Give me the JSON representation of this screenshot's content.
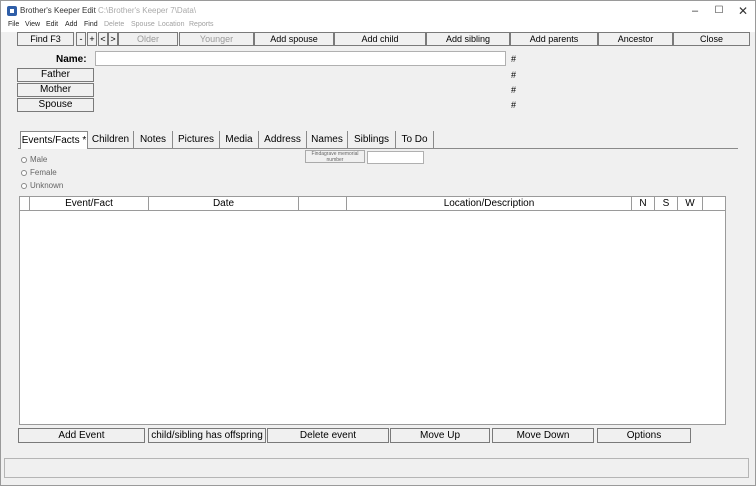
{
  "window": {
    "title_main": "Brother's Keeper Edit",
    "title_path": "C:\\Brother's Keeper 7\\Data\\",
    "controls": {
      "minimize": "–",
      "maximize": "☐",
      "close": "✕"
    }
  },
  "menu": {
    "items": [
      {
        "label": "File",
        "enabled": true
      },
      {
        "label": "View",
        "enabled": true
      },
      {
        "label": "Edit",
        "enabled": true
      },
      {
        "label": "Add",
        "enabled": true
      },
      {
        "label": "Find",
        "enabled": true
      },
      {
        "label": "Delete",
        "enabled": false
      },
      {
        "label": "Spouse",
        "enabled": false
      },
      {
        "label": "Location",
        "enabled": false
      },
      {
        "label": "Reports",
        "enabled": false
      }
    ]
  },
  "toolbar": {
    "find": "Find  F3",
    "minus": "-",
    "plus": "+",
    "prev": "<",
    "next": ">",
    "older": "Older",
    "younger": "Younger",
    "add_spouse": "Add spouse",
    "add_child": "Add child",
    "add_sibling": "Add sibling",
    "add_parents": "Add parents",
    "ancestor": "Ancestor",
    "close": "Close"
  },
  "person": {
    "name_label": "Name:",
    "name_value": "",
    "father": "Father",
    "mother": "Mother",
    "spouse": "Spouse",
    "hash": "#"
  },
  "tabs": [
    "Events/Facts *",
    "Children",
    "Notes",
    "Pictures",
    "Media",
    "Address",
    "Names",
    "Siblings",
    "To Do"
  ],
  "sex": {
    "male": "Male",
    "female": "Female",
    "unknown": "Unknown"
  },
  "memorial": {
    "button": "Findagrave memorial number",
    "value": ""
  },
  "grid": {
    "columns": [
      "",
      "Event/Fact",
      "Date",
      "",
      "Location/Description",
      "N",
      "S",
      "W"
    ]
  },
  "actions": {
    "add_event": "Add Event",
    "offspring": "child/sibling has offspring",
    "delete_event": "Delete event",
    "move_up": "Move Up",
    "move_down": "Move Down",
    "options": "Options"
  }
}
